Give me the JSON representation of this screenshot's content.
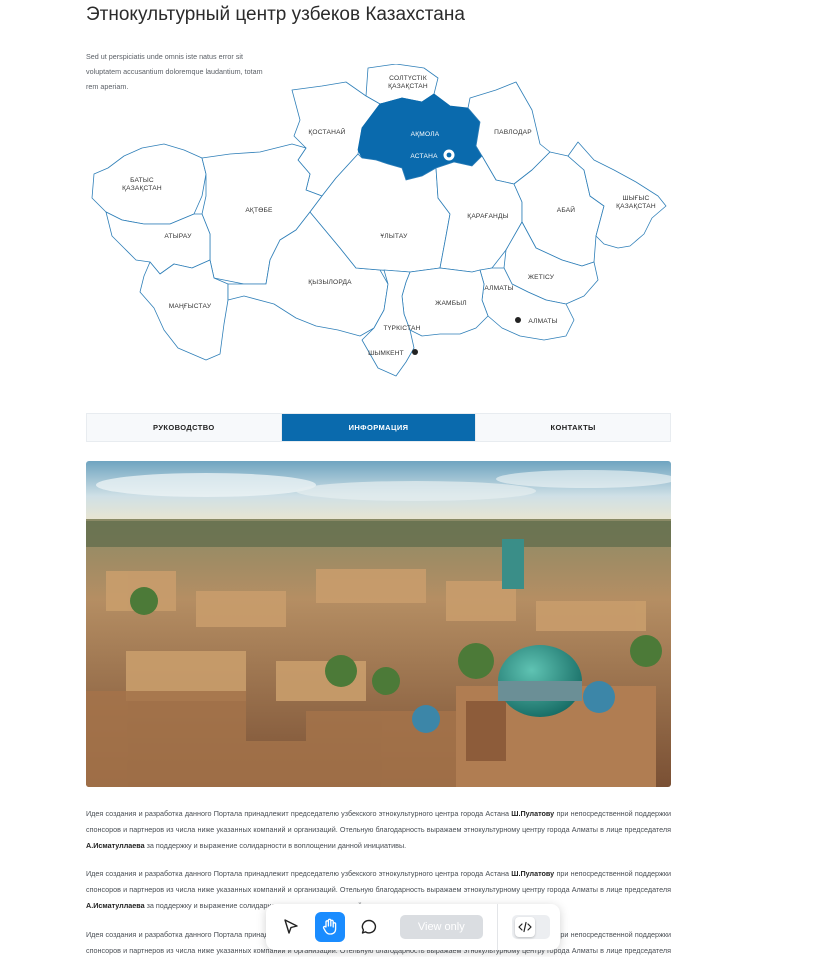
{
  "page": {
    "title": "Этнокультурный центр узбеков Казахстана",
    "intro": "Sed ut perspiciatis unde omnis iste natus error sit voluptatem accusantium doloremque laudantium, totam rem aperiam."
  },
  "map": {
    "regions": {
      "solt": "СОЛТҮСТІК",
      "solt2": "ҚАЗАҚСТАН",
      "kostanai": "ҚОСТАНАЙ",
      "akmola": "АҚМОЛА",
      "astana": "АСТАНА",
      "pavlodar": "ПАВЛОДАР",
      "batys": "БАТЫС",
      "batys2": "ҚАЗАҚСТАН",
      "aktobe": "АҚТӨБЕ",
      "shygys": "ШЫҒЫС",
      "shygys2": "ҚАЗАҚСТАН",
      "abai": "АБАЙ",
      "atyrau": "АТЫРАУ",
      "ulytau": "ҰЛЫТАУ",
      "karagandy": "ҚАРАҒАНДЫ",
      "zhetysu": "ЖЕТІСУ",
      "kyzylorda": "ҚЫЗЫЛОРДА",
      "almaty_reg": "АЛМАТЫ",
      "mangystau": "МАҢҒЫСТАУ",
      "zhambyl": "ЖАМБЫЛ",
      "almaty_city": "АЛМАТЫ",
      "turkistan": "ТҮРКІСТАН",
      "shymkent": "ШЫМКЕНТ"
    },
    "accent_color": "#0a6aad"
  },
  "tabs": [
    {
      "label": "РУКОВОДСТВО"
    },
    {
      "label": "ИНФОРМАЦИЯ",
      "active": true
    },
    {
      "label": "КОНТАКТЫ"
    }
  ],
  "article": {
    "p_start": "Идея создания и разработка данного Портала принадлежит председателю узбекского этнокультурного центра города Астана",
    "p_name1": "Ш.Пулатову",
    "p_mid": "при непосредственной поддержки спонсоров и партнеров из числа ниже указанных компаний и организаций. Отельную благодарность выражаем этнокультурному центру города Алматы в лице председателя",
    "p_name2": "А.Исматуллаева",
    "p_end": "за поддержку и выражение солидарности в воплощении данной инициативы."
  },
  "toolbar": {
    "view_only": "View only",
    "icons": [
      "cursor-icon",
      "hand-icon",
      "comment-icon",
      "code-icon"
    ]
  }
}
